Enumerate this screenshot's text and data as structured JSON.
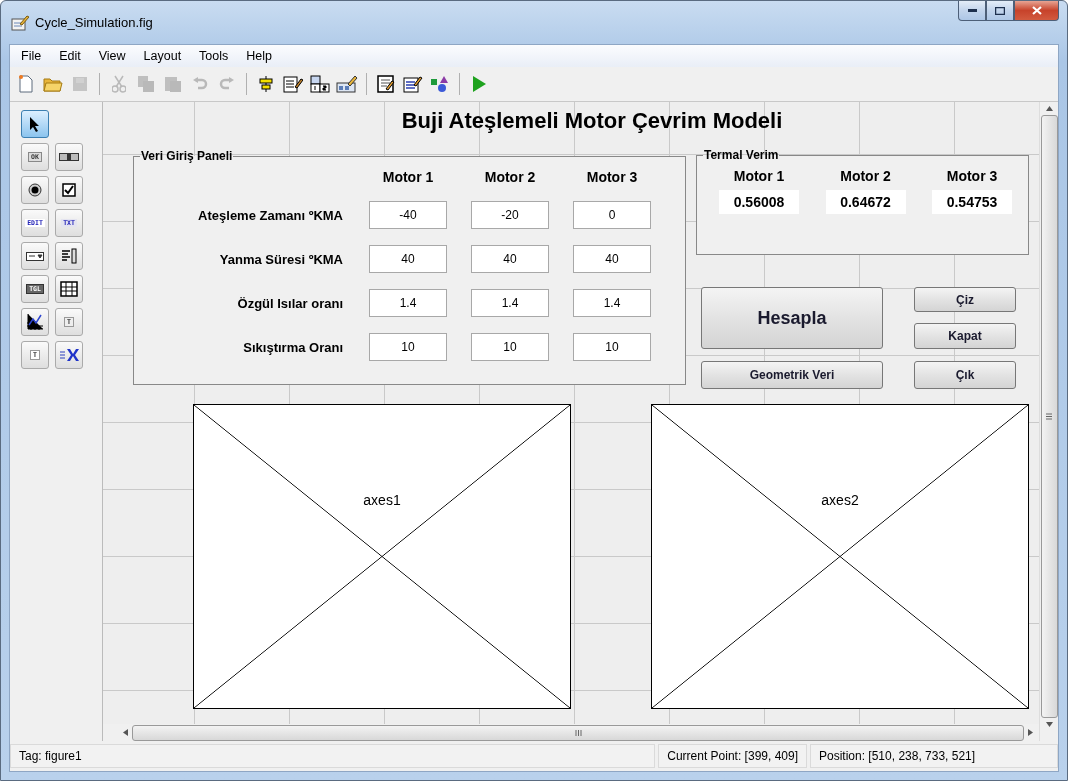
{
  "window": {
    "title": "Cycle_Simulation.fig"
  },
  "menu": [
    "File",
    "Edit",
    "View",
    "Layout",
    "Tools",
    "Help"
  ],
  "toolbar": [
    {
      "kind": "new",
      "disabled": false
    },
    {
      "kind": "open",
      "disabled": false
    },
    {
      "kind": "save",
      "disabled": true
    },
    {
      "kind": "sep"
    },
    {
      "kind": "cut",
      "disabled": true
    },
    {
      "kind": "copy",
      "disabled": true
    },
    {
      "kind": "paste",
      "disabled": true
    },
    {
      "kind": "undo",
      "disabled": true
    },
    {
      "kind": "redo",
      "disabled": true
    },
    {
      "kind": "sep"
    },
    {
      "kind": "align",
      "disabled": false
    },
    {
      "kind": "menu-editor",
      "disabled": false
    },
    {
      "kind": "tab-order",
      "disabled": false
    },
    {
      "kind": "toolbar-editor",
      "disabled": false
    },
    {
      "kind": "sep"
    },
    {
      "kind": "editor",
      "disabled": false
    },
    {
      "kind": "inspector",
      "disabled": false
    },
    {
      "kind": "browser",
      "disabled": false
    },
    {
      "kind": "sep"
    },
    {
      "kind": "run",
      "disabled": false
    }
  ],
  "palette": [
    {
      "kind": "pointer",
      "selected": true
    },
    {
      "kind": "push",
      "label": "OK",
      "selected": false
    },
    {
      "kind": "slider",
      "selected": false
    },
    {
      "kind": "radio",
      "selected": false
    },
    {
      "kind": "checkbox",
      "selected": false
    },
    {
      "kind": "edit",
      "label": "EDIT",
      "selected": false
    },
    {
      "kind": "text",
      "label": "TXT",
      "selected": false
    },
    {
      "kind": "popup",
      "selected": false
    },
    {
      "kind": "listbox",
      "selected": false
    },
    {
      "kind": "toggle",
      "label": "TGL",
      "selected": false
    },
    {
      "kind": "table",
      "selected": false
    },
    {
      "kind": "axes",
      "selected": false
    },
    {
      "kind": "panel",
      "label": "T",
      "selected": false
    },
    {
      "kind": "buttongroup",
      "label": "T",
      "selected": false
    },
    {
      "kind": "activex",
      "selected": false
    }
  ],
  "canvas": {
    "title": "Buji Ateşlemeli Motor Çevrim Modeli",
    "input_panel": {
      "title": "Veri Giriş Paneli",
      "columns": [
        "Motor 1",
        "Motor 2",
        "Motor 3"
      ],
      "rows": [
        {
          "label": "Ateşleme Zamanı  ºKMA",
          "values": [
            "-40",
            "-20",
            "0"
          ]
        },
        {
          "label": "Yanma Süresi ºKMA",
          "values": [
            "40",
            "40",
            "40"
          ]
        },
        {
          "label": "Özgül Isılar oranı",
          "values": [
            "1.4",
            "1.4",
            "1.4"
          ]
        },
        {
          "label": "Sıkıştırma Oranı",
          "values": [
            "10",
            "10",
            "10"
          ]
        }
      ]
    },
    "efficiency_panel": {
      "title": "Termal Verim",
      "columns": [
        "Motor 1",
        "Motor 2",
        "Motor 3"
      ],
      "values": [
        "0.56008",
        "0.64672",
        "0.54753"
      ]
    },
    "buttons": [
      {
        "label": "Çiz",
        "kind": "small"
      },
      {
        "label": "Hesapla",
        "kind": "large"
      },
      {
        "label": "Kapat",
        "kind": "small"
      },
      {
        "label": "Geometrik Veri",
        "kind": "wide"
      },
      {
        "label": "Çık",
        "kind": "small"
      }
    ],
    "axes": [
      "axes1",
      "axes2"
    ]
  },
  "status_bar": {
    "tag": "Tag: figure1",
    "current_point": "Current Point:  [399, 409]",
    "position": "Position: [510, 238, 733, 521]"
  }
}
